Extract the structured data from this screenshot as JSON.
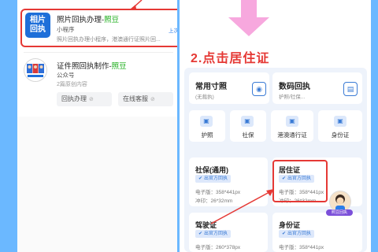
{
  "miniapp": {
    "logo_line1": "相片",
    "logo_line2": "回执",
    "title_main": "照片回执办理-",
    "title_accent": "照豆",
    "subtitle": "小程序",
    "description": "照片回执办理小程序，港澳通行证照片回...",
    "recent_label": "上次使用"
  },
  "official_account": {
    "title_main": "证件照回执制作-",
    "title_accent": "照豆",
    "subtitle": "公众号",
    "recent": "2篇原创内容",
    "buttons": [
      "回执办理",
      "在线客服"
    ]
  },
  "step": {
    "title": "2.点击居住证"
  },
  "top_cards": [
    {
      "title": "常用寸照",
      "sub": "(无裁执)",
      "icon": "camera-icon"
    },
    {
      "title": "数码回执",
      "sub": "护照/社保...",
      "icon": "id-card-icon"
    }
  ],
  "small_cards": [
    {
      "label": "护照",
      "icon": "passport-icon"
    },
    {
      "label": "社保",
      "icon": "social-security-icon"
    },
    {
      "label": "港澳通行证",
      "icon": "travel-permit-icon"
    },
    {
      "label": "身份证",
      "icon": "id-icon"
    }
  ],
  "doc_cards": [
    {
      "title": "社保(通用)",
      "badge": "出官方回执",
      "px": "电子版：358*441px",
      "mm": "冲印：26*32mm"
    },
    {
      "title": "居住证",
      "badge": "出官方回执",
      "px": "电子版：358*441px",
      "mm": "冲印：26*32mm"
    },
    {
      "title": "驾驶证",
      "badge": "出官方回执",
      "px": "电子版：260*378px",
      "mm": ""
    },
    {
      "title": "身份证",
      "badge": "出官方回执",
      "px": "电子版：358*441px",
      "mm": ""
    }
  ],
  "avatar_label": "照豆回执",
  "colors": {
    "background": "#6bb8ff",
    "highlight": "#e53935",
    "accent_green": "#1aad19",
    "link_blue": "#2b7de9",
    "arrow_pink": "#f7a8de"
  }
}
